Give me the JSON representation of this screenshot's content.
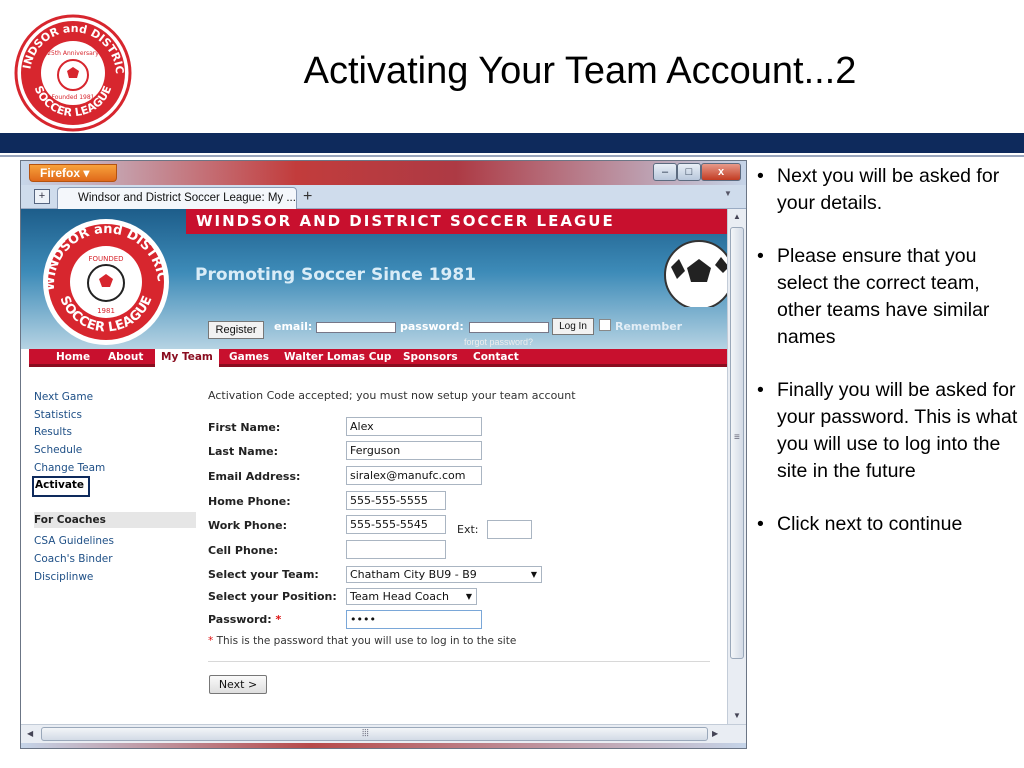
{
  "slide": {
    "title": "Activating Your Team Account...2",
    "logo_text": {
      "top": "WINDSOR and DISTRICT",
      "bottom": "SOCCER LEAGUE",
      "anniversary": "25th Anniversary",
      "founded": "Founded 1981"
    },
    "bullets": [
      "Next you will be asked for your details.",
      "Please ensure that you select the correct team, other teams have similar names",
      "Finally you will be asked for your password. This is what you will use to log into the site in the future",
      "Click next to continue"
    ],
    "bullet_glyph": "•"
  },
  "browser": {
    "menu_button": "Firefox ▾",
    "tab_title": "Windsor and District Soccer League: My ...",
    "new_tab": "+",
    "window_buttons": {
      "min": "–",
      "max": "□",
      "close": "x"
    }
  },
  "site": {
    "league_name": "WINDSOR AND DISTRICT SOCCER LEAGUE",
    "tagline": "Promoting Soccer Since 1981",
    "logo_text": {
      "top": "WINDSOR and DISTRICT",
      "bottom": "SOCCER LEAGUE",
      "founded": "FOUNDED",
      "year": "1981"
    },
    "login": {
      "register": "Register",
      "email_label": "email:",
      "password_label": "password:",
      "login_button": "Log In",
      "remember": "Remember",
      "forgot": "forgot password?"
    },
    "nav": [
      "Home",
      "About",
      "My Team",
      "Games",
      "Walter Lomas Cup",
      "Sponsors",
      "Contact"
    ],
    "left_nav": [
      "Next Game",
      "Statistics",
      "Results",
      "Schedule",
      "Change Team",
      "Activate"
    ],
    "coaches_heading": "For Coaches",
    "coaches_nav": [
      "CSA Guidelines",
      "Coach's Binder",
      "Disciplinwe"
    ]
  },
  "form": {
    "accepted_msg": "Activation Code accepted; you must now setup your team account",
    "first_name": {
      "label": "First Name:",
      "value": "Alex"
    },
    "last_name": {
      "label": "Last Name:",
      "value": "Ferguson"
    },
    "email": {
      "label": "Email Address:",
      "value": "siralex@manufc.com"
    },
    "home_phone": {
      "label": "Home Phone:",
      "value": "555-555-5555"
    },
    "work_phone": {
      "label": "Work Phone:",
      "value": "555-555-5545"
    },
    "ext_label": "Ext:",
    "cell_phone": {
      "label": "Cell Phone:",
      "value": ""
    },
    "team": {
      "label": "Select your Team:",
      "value": "Chatham City BU9 - B9"
    },
    "position": {
      "label": "Select your Position:",
      "value": "Team Head Coach"
    },
    "password": {
      "label": "Password:",
      "value": "••••",
      "required_mark": "*"
    },
    "password_note_mark": "*",
    "password_note": "This is the password that you will use to log in to the site",
    "next_button": "Next >"
  },
  "colors": {
    "navy_band": "#0e2a5c",
    "league_red": "#c8102e",
    "link_blue": "#1e4f86"
  }
}
